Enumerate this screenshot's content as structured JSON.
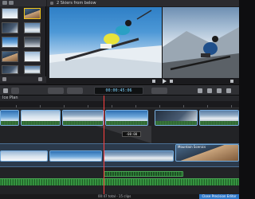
{
  "viewer": {
    "title": "2 Skiers from below"
  },
  "toolbar": {
    "timecode": "00:00:45:06"
  },
  "timeline": {
    "project_label": "Ice Plan",
    "playhead_readout": "-00:00",
    "clip_label": "Mountain Scenics"
  },
  "status": {
    "summary": "00:47 total - 15 clips",
    "preview_button": "Close Precision Editor"
  },
  "colors": {
    "accent": "#2e78c9",
    "playhead": "#ff4040",
    "audio": "#2f8a39"
  }
}
